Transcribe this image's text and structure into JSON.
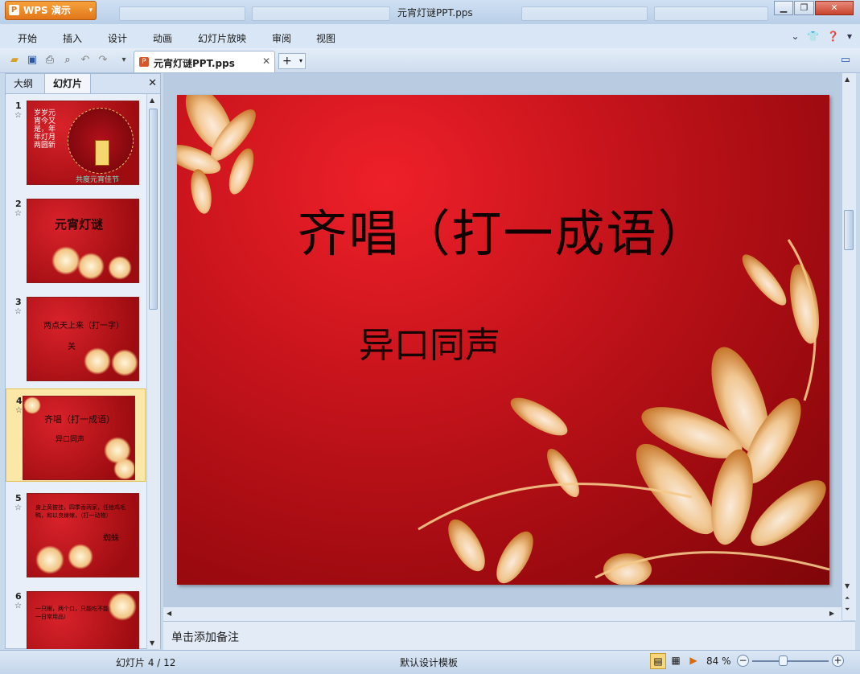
{
  "titlebar": {
    "app_name": "WPS 演示",
    "window_title": "元宵灯谜PPT.pps"
  },
  "menubar": {
    "items": [
      "开始",
      "插入",
      "设计",
      "动画",
      "幻灯片放映",
      "审阅",
      "视图"
    ]
  },
  "document_tab": {
    "name": "元宵灯谜PPT.pps"
  },
  "left_pane": {
    "tabs": [
      "大纲",
      "幻灯片"
    ],
    "active_tab": "幻灯片",
    "slides": [
      {
        "num": "1",
        "text": "岁岁元宵今又是，年年灯月两圆新",
        "caption": "共度元宵佳节"
      },
      {
        "num": "2",
        "text": "元宵灯谜"
      },
      {
        "num": "3",
        "text": "两点天上来（打一字）",
        "answer": "关"
      },
      {
        "num": "4",
        "text": "齐唱（打一成语）",
        "answer": "异口同声",
        "selected": true
      },
      {
        "num": "5",
        "text": "身上黄披挂，四季香两家，任他鸡毛鸭，和以良嫁嫁，（打一动物）",
        "answer": "蜘蛛"
      },
      {
        "num": "6",
        "text": "一只眼，两个口，只能吃不能喝。（打一日常用品）"
      }
    ]
  },
  "slide": {
    "title": "齐唱（打一成语）",
    "body": "异口同声"
  },
  "notes": {
    "placeholder": "单击添加备注"
  },
  "statusbar": {
    "page": "幻灯片 4 / 12",
    "template": "默认设计模板",
    "zoom": "84 %"
  },
  "colors": {
    "slide_red": "#c8141c",
    "accent_orange": "#e2761a",
    "selection": "#fbe7a7"
  }
}
